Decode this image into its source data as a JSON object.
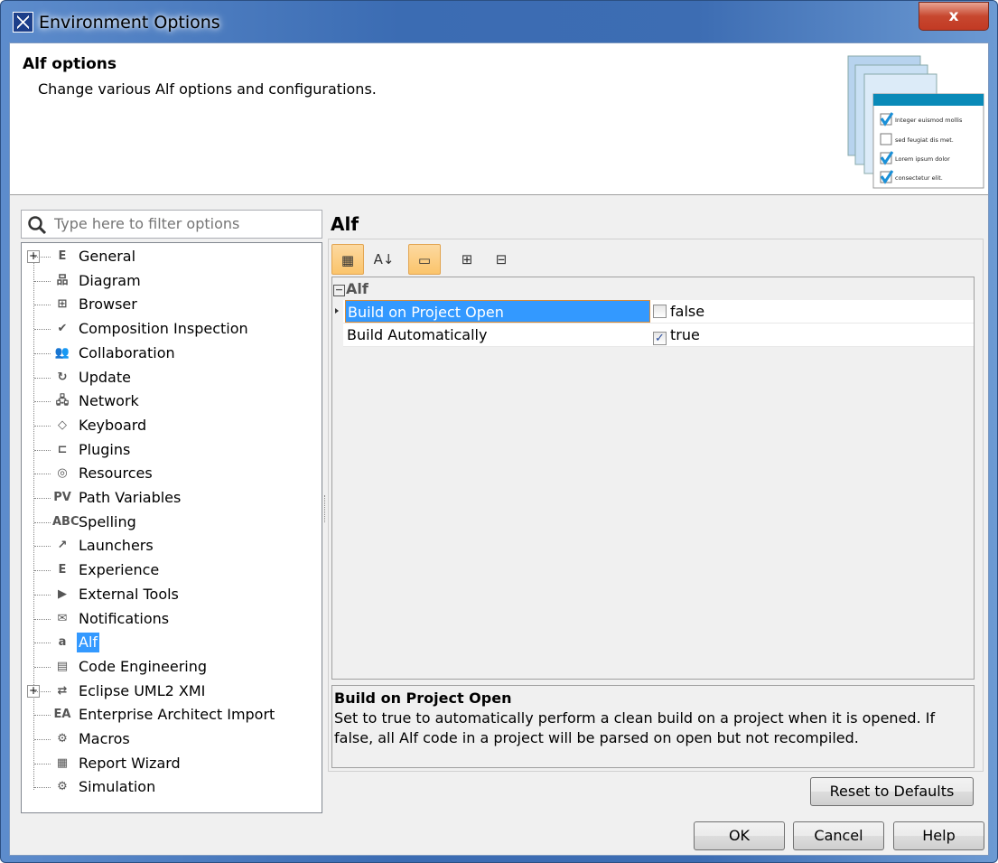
{
  "window": {
    "title": "Environment Options",
    "close_label": "x"
  },
  "header": {
    "title": "Alf options",
    "description": "Change various Alf options and configurations.",
    "image_text": [
      "Integer euismod mollis",
      "sed feugiat dis met.",
      "Lorem ipsum dolor",
      "consectetur elit."
    ]
  },
  "filter": {
    "placeholder": "Type here to filter options",
    "value": ""
  },
  "tree": [
    {
      "label": "General",
      "icon": "E",
      "expandable": true
    },
    {
      "label": "Diagram",
      "icon": "品"
    },
    {
      "label": "Browser",
      "icon": "⊞"
    },
    {
      "label": "Composition Inspection",
      "icon": "✔"
    },
    {
      "label": "Collaboration",
      "icon": "👥"
    },
    {
      "label": "Update",
      "icon": "↻"
    },
    {
      "label": "Network",
      "icon": "🖧"
    },
    {
      "label": "Keyboard",
      "icon": "◇"
    },
    {
      "label": "Plugins",
      "icon": "⊏"
    },
    {
      "label": "Resources",
      "icon": "◎"
    },
    {
      "label": "Path Variables",
      "icon": "PV"
    },
    {
      "label": "Spelling",
      "icon": "ABC"
    },
    {
      "label": "Launchers",
      "icon": "↗"
    },
    {
      "label": "Experience",
      "icon": "E"
    },
    {
      "label": "External Tools",
      "icon": "▶"
    },
    {
      "label": "Notifications",
      "icon": "✉"
    },
    {
      "label": "Alf",
      "icon": "a",
      "selected": true
    },
    {
      "label": "Code Engineering",
      "icon": "▤"
    },
    {
      "label": "Eclipse UML2 XMI",
      "icon": "⇄",
      "expandable": true
    },
    {
      "label": "Enterprise Architect Import",
      "icon": "EA"
    },
    {
      "label": "Macros",
      "icon": "⚙"
    },
    {
      "label": "Report Wizard",
      "icon": "▦"
    },
    {
      "label": "Simulation",
      "icon": "⚙"
    }
  ],
  "panel": {
    "title": "Alf",
    "toolbar": [
      {
        "name": "categorized-view",
        "icon": "▦",
        "active": true
      },
      {
        "name": "sort-alphabetical",
        "icon": "A↓"
      },
      {
        "name": "show-description",
        "icon": "▭",
        "active": true
      },
      {
        "name": "expand-all",
        "icon": "⊞"
      },
      {
        "name": "collapse-all",
        "icon": "⊟"
      }
    ],
    "category": "Alf",
    "properties": [
      {
        "name": "Build on Project Open",
        "value": "false",
        "checked": false,
        "selected": true
      },
      {
        "name": "Build Automatically",
        "value": "true",
        "checked": true
      }
    ],
    "description": {
      "title": "Build on Project Open",
      "text": "Set to true to automatically perform a clean build on a project when it is opened. If false, all Alf code in a project will be parsed on open but not recompiled."
    }
  },
  "buttons": {
    "reset": "Reset to Defaults",
    "ok": "OK",
    "cancel": "Cancel",
    "help": "Help"
  }
}
